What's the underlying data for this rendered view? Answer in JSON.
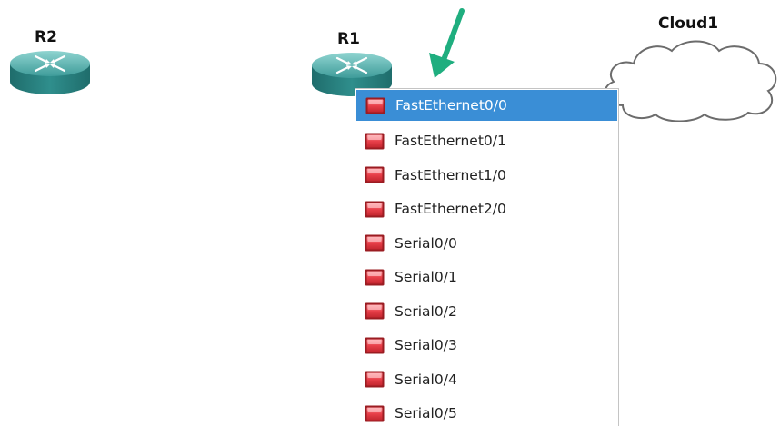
{
  "nodes": {
    "r2": {
      "label": "R2"
    },
    "r1": {
      "label": "R1"
    },
    "cloud1": {
      "label": "Cloud1"
    }
  },
  "port_menu": {
    "items": [
      {
        "label": "FastEthernet0/0",
        "selected": true
      },
      {
        "label": "FastEthernet0/1",
        "selected": false
      },
      {
        "label": "FastEthernet1/0",
        "selected": false
      },
      {
        "label": "FastEthernet2/0",
        "selected": false
      },
      {
        "label": "Serial0/0",
        "selected": false
      },
      {
        "label": "Serial0/1",
        "selected": false
      },
      {
        "label": "Serial0/2",
        "selected": false
      },
      {
        "label": "Serial0/3",
        "selected": false
      },
      {
        "label": "Serial0/4",
        "selected": false
      },
      {
        "label": "Serial0/5",
        "selected": false
      }
    ],
    "port_icon": "red-port-icon"
  },
  "annotation": {
    "icon": "green-arrow-icon",
    "color": "#1fae7f"
  },
  "colors": {
    "selection": "#3a8ed6",
    "router_body": "#2e8b8b",
    "port_red": "#e8404a"
  }
}
